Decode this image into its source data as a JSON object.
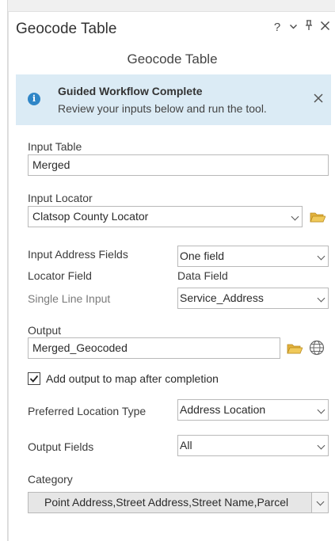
{
  "pane": {
    "title": "Geocode Table",
    "controls": {
      "help": "?",
      "menu": "⌄",
      "pin": "⊥",
      "close": "✕"
    }
  },
  "tool_title": "Geocode Table",
  "banner": {
    "icon": "info-icon",
    "title": "Guided Workflow Complete",
    "message": "Review your inputs below and run the tool.",
    "close": "✕"
  },
  "input_table": {
    "label": "Input Table",
    "value": "Merged"
  },
  "input_locator": {
    "label": "Input Locator",
    "value": "Clatsop County Locator",
    "icon": "folder-icon"
  },
  "address_fields": {
    "label": "Input Address Fields",
    "value": "One field",
    "col_locator": "Locator Field",
    "col_data": "Data Field",
    "row_label": "Single Line Input",
    "row_value": "Service_Address"
  },
  "output": {
    "label": "Output",
    "value": "Merged_Geocoded",
    "icons": [
      "folder-icon",
      "globe-icon"
    ]
  },
  "add_to_map": {
    "label": "Add output to map after completion",
    "checked": true
  },
  "preferred_location": {
    "label": "Preferred Location Type",
    "value": "Address Location"
  },
  "output_fields": {
    "label": "Output Fields",
    "value": "All"
  },
  "category": {
    "label": "Category",
    "value": "Point Address,Street Address,Street Name,Parcel"
  },
  "colors": {
    "banner_bg": "#dbebf5",
    "info_blue": "#2f86c7",
    "folder_yellow": "#e2b13c"
  }
}
